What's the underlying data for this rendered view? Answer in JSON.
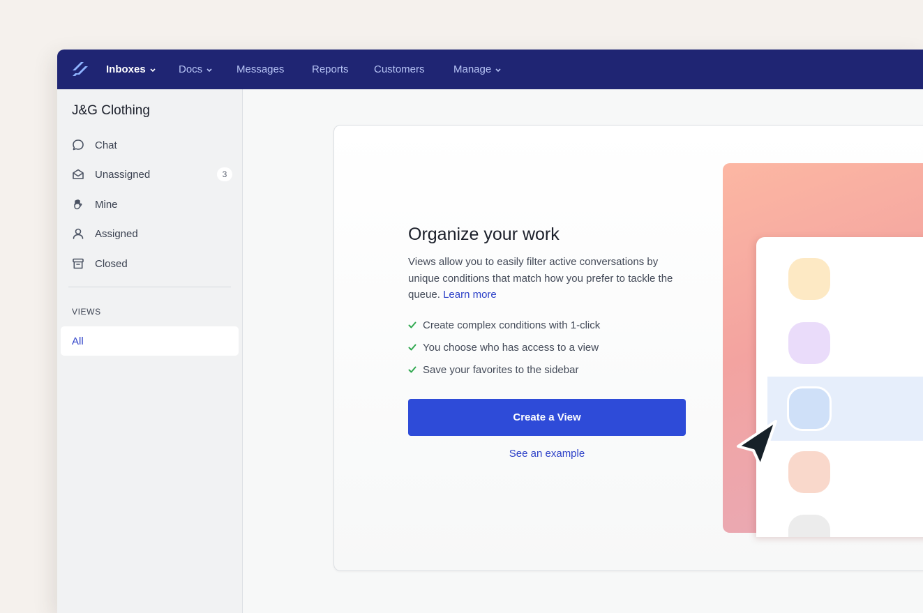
{
  "nav": {
    "items": [
      {
        "label": "Inboxes",
        "has_dropdown": true,
        "active": true
      },
      {
        "label": "Docs",
        "has_dropdown": true,
        "active": false
      },
      {
        "label": "Messages",
        "has_dropdown": false,
        "active": false
      },
      {
        "label": "Reports",
        "has_dropdown": false,
        "active": false
      },
      {
        "label": "Customers",
        "has_dropdown": false,
        "active": false
      },
      {
        "label": "Manage",
        "has_dropdown": true,
        "active": false
      }
    ]
  },
  "sidebar": {
    "workspace": "J&G Clothing",
    "items": [
      {
        "label": "Chat",
        "icon": "chat-bubble-icon"
      },
      {
        "label": "Unassigned",
        "icon": "open-envelope-icon",
        "count": "3"
      },
      {
        "label": "Mine",
        "icon": "hand-icon"
      },
      {
        "label": "Assigned",
        "icon": "person-icon"
      },
      {
        "label": "Closed",
        "icon": "archive-box-icon"
      }
    ],
    "views_heading": "VIEWS",
    "views": [
      {
        "label": "All",
        "selected": true
      }
    ]
  },
  "card": {
    "title": "Organize your work",
    "description": "Views allow you to easily filter active conversations by unique conditions that match how you prefer to tackle the queue.",
    "learn_more": "Learn more",
    "features": [
      "Create complex conditions with 1-click",
      "You choose who has access to a view",
      "Save your favorites to the sidebar"
    ],
    "cta": "Create a View",
    "secondary_link": "See an example"
  },
  "colors": {
    "nav_bg": "#1f2573",
    "accent": "#2e4bd8",
    "link": "#2b3fc7",
    "check": "#2fa84f",
    "page_bg": "#f5f1ed"
  }
}
